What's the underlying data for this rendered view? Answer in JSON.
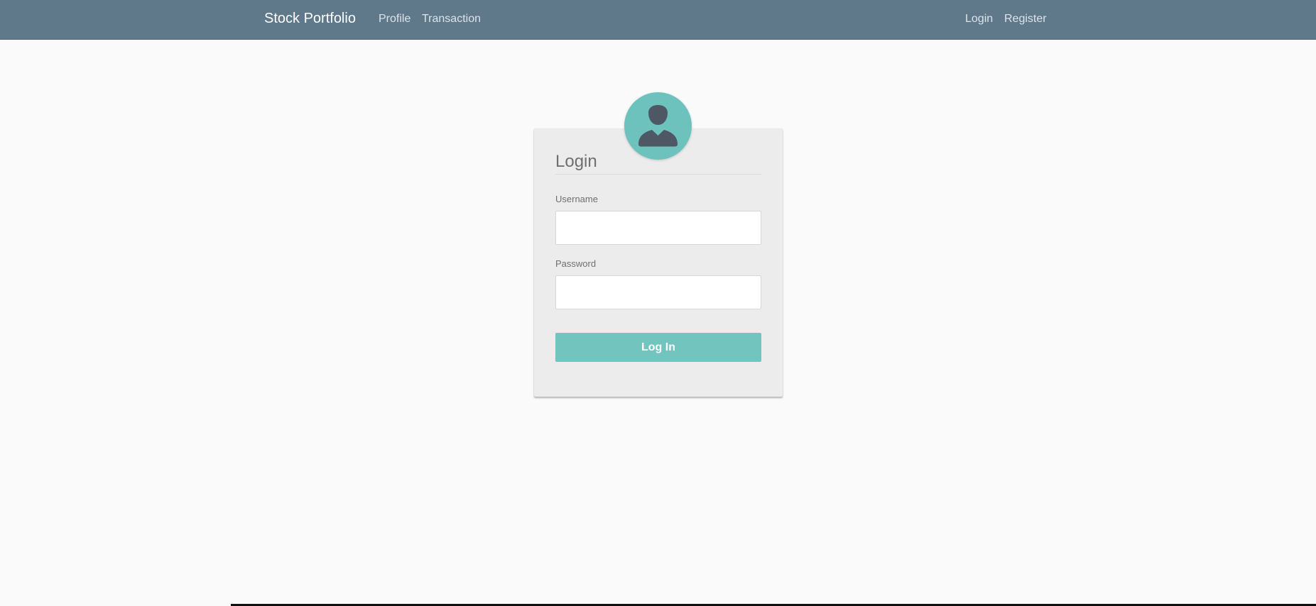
{
  "navbar": {
    "brand": "Stock Portfolio",
    "left_links": [
      "Profile",
      "Transaction"
    ],
    "right_links": [
      "Login",
      "Register"
    ]
  },
  "login_card": {
    "avatar_icon": "user-avatar-icon",
    "title": "Login",
    "username_label": "Username",
    "username_value": "",
    "password_label": "Password",
    "password_value": "",
    "submit_label": "Log In"
  },
  "colors": {
    "navbar_bg": "#5f788a",
    "accent": "#72c4be",
    "avatar_bg": "#6dc2bd",
    "avatar_figure": "#4d5864",
    "page_bg": "#fafafa",
    "card_bg": "#ececec"
  }
}
